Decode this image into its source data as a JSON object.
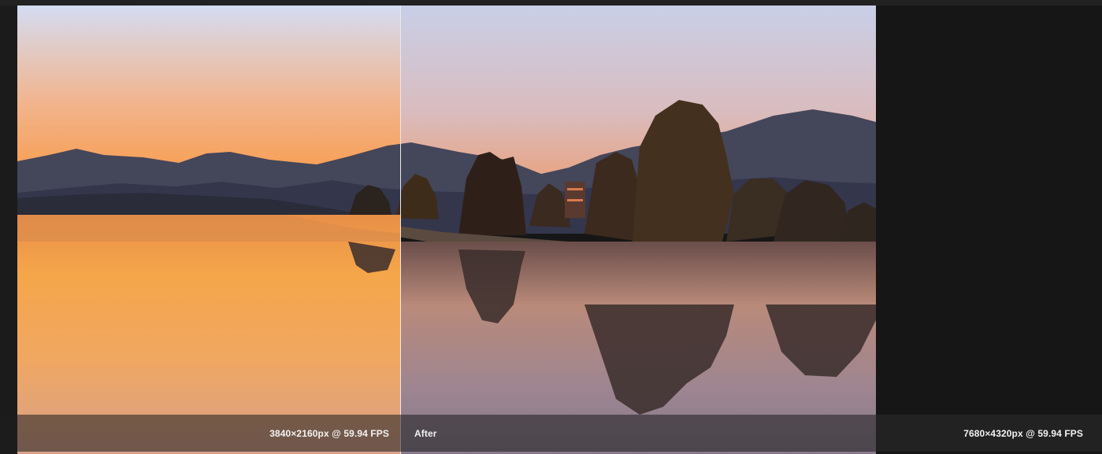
{
  "comparison": {
    "before_label": "3840×2160px @ 59.94 FPS",
    "after_label": "After",
    "after_resolution": "7680×4320px @ 59.94 FPS"
  },
  "image": {
    "description_icon": "landscape-image-icon"
  },
  "colors": {
    "sky_top": "#d6dcf0",
    "sky_orange": "#f7a35c",
    "mountain": "#3d3f4f",
    "water_orange": "#f5a64a",
    "background": "#161616"
  }
}
